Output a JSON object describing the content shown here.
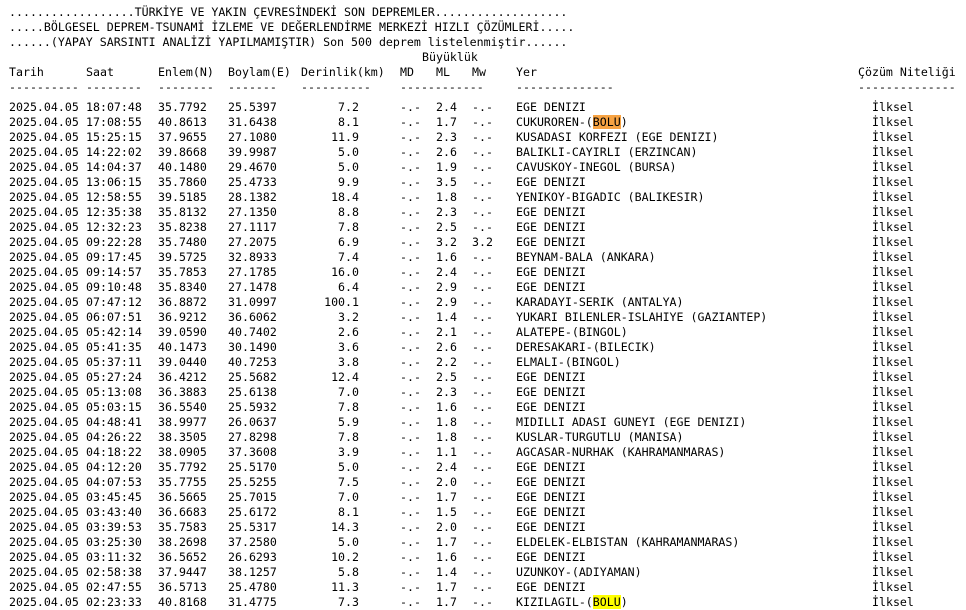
{
  "header": {
    "line1": "..................TÜRKİYE VE YAKIN ÇEVRESİNDEKİ SON DEPREMLER...................",
    "line2": ".....BÖLGESEL DEPREM-TSUNAMİ İZLEME VE DEĞERLENDİRME MERKEZİ HIZLI ÇÖZÜMLERİ.....",
    "line3": "......(YAPAY SARSINTI ANALİZİ YAPILMAMIŞTIR) Son 500 deprem listelenmiştir......"
  },
  "columns": {
    "magnitude_group": "Büyüklük",
    "date": "Tarih",
    "time": "Saat",
    "lat": "Enlem(N)",
    "lon": "Boylam(E)",
    "depth": "Derinlik(km)",
    "md": "MD",
    "ml": "ML",
    "mw": "Mw",
    "place": "Yer",
    "quality": "Çözüm Niteliği"
  },
  "separators": {
    "date": "----------",
    "time": "--------",
    "lat": "--------",
    "lon": "-------",
    "depth": "----------",
    "mag": "------------",
    "place": "--------------",
    "quality": "--------------"
  },
  "rows": [
    {
      "date": "2025.04.05",
      "time": "18:07:48",
      "lat": "35.7792",
      "lon": "25.5397",
      "depth": "7.2",
      "md": "-.-",
      "ml": "2.4",
      "mw": "-.-",
      "place": "EGE DENIZI",
      "quality": "İlksel"
    },
    {
      "date": "2025.04.05",
      "time": "17:08:55",
      "lat": "40.8613",
      "lon": "31.6438",
      "depth": "8.1",
      "md": "-.-",
      "ml": "1.7",
      "mw": "-.-",
      "place_pre": "CUKUROREN-(",
      "place_mark": "BOLU",
      "place_post": ")",
      "mark": "orange",
      "quality": "İlksel"
    },
    {
      "date": "2025.04.05",
      "time": "15:25:15",
      "lat": "37.9655",
      "lon": "27.1080",
      "depth": "11.9",
      "md": "-.-",
      "ml": "2.3",
      "mw": "-.-",
      "place": "KUSADASI KORFEZI (EGE DENIZI)",
      "quality": "İlksel"
    },
    {
      "date": "2025.04.05",
      "time": "14:22:02",
      "lat": "39.8668",
      "lon": "39.9987",
      "depth": "5.0",
      "md": "-.-",
      "ml": "2.6",
      "mw": "-.-",
      "place": "BALIKLI-CAYIRLI (ERZINCAN)",
      "quality": "İlksel"
    },
    {
      "date": "2025.04.05",
      "time": "14:04:37",
      "lat": "40.1480",
      "lon": "29.4670",
      "depth": "5.0",
      "md": "-.-",
      "ml": "1.9",
      "mw": "-.-",
      "place": "CAVUSKOY-INEGOL (BURSA)",
      "quality": "İlksel"
    },
    {
      "date": "2025.04.05",
      "time": "13:06:15",
      "lat": "35.7860",
      "lon": "25.4733",
      "depth": "9.9",
      "md": "-.-",
      "ml": "3.5",
      "mw": "-.-",
      "place": "EGE DENIZI",
      "quality": "İlksel"
    },
    {
      "date": "2025.04.05",
      "time": "12:58:55",
      "lat": "39.5185",
      "lon": "28.1382",
      "depth": "18.4",
      "md": "-.-",
      "ml": "1.8",
      "mw": "-.-",
      "place": "YENIKOY-BIGADIC (BALIKESIR)",
      "quality": "İlksel"
    },
    {
      "date": "2025.04.05",
      "time": "12:35:38",
      "lat": "35.8132",
      "lon": "27.1350",
      "depth": "8.8",
      "md": "-.-",
      "ml": "2.3",
      "mw": "-.-",
      "place": "EGE DENIZI",
      "quality": "İlksel"
    },
    {
      "date": "2025.04.05",
      "time": "12:32:23",
      "lat": "35.8238",
      "lon": "27.1117",
      "depth": "7.8",
      "md": "-.-",
      "ml": "2.5",
      "mw": "-.-",
      "place": "EGE DENIZI",
      "quality": "İlksel"
    },
    {
      "date": "2025.04.05",
      "time": "09:22:28",
      "lat": "35.7480",
      "lon": "27.2075",
      "depth": "6.9",
      "md": "-.-",
      "ml": "3.2",
      "mw": "3.2",
      "place": "EGE DENIZI",
      "quality": "İlksel"
    },
    {
      "date": "2025.04.05",
      "time": "09:17:45",
      "lat": "39.5725",
      "lon": "32.8933",
      "depth": "7.4",
      "md": "-.-",
      "ml": "1.6",
      "mw": "-.-",
      "place": "BEYNAM-BALA (ANKARA)",
      "quality": "İlksel"
    },
    {
      "date": "2025.04.05",
      "time": "09:14:57",
      "lat": "35.7853",
      "lon": "27.1785",
      "depth": "16.0",
      "md": "-.-",
      "ml": "2.4",
      "mw": "-.-",
      "place": "EGE DENIZI",
      "quality": "İlksel"
    },
    {
      "date": "2025.04.05",
      "time": "09:10:48",
      "lat": "35.8340",
      "lon": "27.1478",
      "depth": "6.4",
      "md": "-.-",
      "ml": "2.9",
      "mw": "-.-",
      "place": "EGE DENIZI",
      "quality": "İlksel"
    },
    {
      "date": "2025.04.05",
      "time": "07:47:12",
      "lat": "36.8872",
      "lon": "31.0997",
      "depth": "100.1",
      "md": "-.-",
      "ml": "2.9",
      "mw": "-.-",
      "place": "KARADAYI-SERIK (ANTALYA)",
      "quality": "İlksel"
    },
    {
      "date": "2025.04.05",
      "time": "06:07:51",
      "lat": "36.9212",
      "lon": "36.6062",
      "depth": "3.2",
      "md": "-.-",
      "ml": "1.4",
      "mw": "-.-",
      "place": "YUKARI BILENLER-ISLAHIYE (GAZIANTEP)",
      "quality": "İlksel"
    },
    {
      "date": "2025.04.05",
      "time": "05:42:14",
      "lat": "39.0590",
      "lon": "40.7402",
      "depth": "2.6",
      "md": "-.-",
      "ml": "2.1",
      "mw": "-.-",
      "place": "ALATEPE-(BINGOL)",
      "quality": "İlksel"
    },
    {
      "date": "2025.04.05",
      "time": "05:41:35",
      "lat": "40.1473",
      "lon": "30.1490",
      "depth": "3.6",
      "md": "-.-",
      "ml": "2.6",
      "mw": "-.-",
      "place": "DERESAKARI-(BILECIK)",
      "quality": "İlksel"
    },
    {
      "date": "2025.04.05",
      "time": "05:37:11",
      "lat": "39.0440",
      "lon": "40.7253",
      "depth": "3.8",
      "md": "-.-",
      "ml": "2.2",
      "mw": "-.-",
      "place": "ELMALI-(BINGOL)",
      "quality": "İlksel"
    },
    {
      "date": "2025.04.05",
      "time": "05:27:24",
      "lat": "36.4212",
      "lon": "25.5682",
      "depth": "12.4",
      "md": "-.-",
      "ml": "2.5",
      "mw": "-.-",
      "place": "EGE DENIZI",
      "quality": "İlksel"
    },
    {
      "date": "2025.04.05",
      "time": "05:13:08",
      "lat": "36.3883",
      "lon": "25.6138",
      "depth": "7.0",
      "md": "-.-",
      "ml": "2.3",
      "mw": "-.-",
      "place": "EGE DENIZI",
      "quality": "İlksel"
    },
    {
      "date": "2025.04.05",
      "time": "05:03:15",
      "lat": "36.5540",
      "lon": "25.5932",
      "depth": "7.8",
      "md": "-.-",
      "ml": "1.6",
      "mw": "-.-",
      "place": "EGE DENIZI",
      "quality": "İlksel"
    },
    {
      "date": "2025.04.05",
      "time": "04:48:41",
      "lat": "38.9977",
      "lon": "26.0637",
      "depth": "5.9",
      "md": "-.-",
      "ml": "1.8",
      "mw": "-.-",
      "place": "MIDILLI ADASI GUNEYI (EGE DENIZI)",
      "quality": "İlksel"
    },
    {
      "date": "2025.04.05",
      "time": "04:26:22",
      "lat": "38.3505",
      "lon": "27.8298",
      "depth": "7.8",
      "md": "-.-",
      "ml": "1.8",
      "mw": "-.-",
      "place": "KUSLAR-TURGUTLU (MANISA)",
      "quality": "İlksel"
    },
    {
      "date": "2025.04.05",
      "time": "04:18:22",
      "lat": "38.0905",
      "lon": "37.3608",
      "depth": "3.9",
      "md": "-.-",
      "ml": "1.1",
      "mw": "-.-",
      "place": "AGCASAR-NURHAK (KAHRAMANMARAS)",
      "quality": "İlksel"
    },
    {
      "date": "2025.04.05",
      "time": "04:12:20",
      "lat": "35.7792",
      "lon": "25.5170",
      "depth": "5.0",
      "md": "-.-",
      "ml": "2.4",
      "mw": "-.-",
      "place": "EGE DENIZI",
      "quality": "İlksel"
    },
    {
      "date": "2025.04.05",
      "time": "04:07:53",
      "lat": "35.7755",
      "lon": "25.5255",
      "depth": "7.5",
      "md": "-.-",
      "ml": "2.0",
      "mw": "-.-",
      "place": "EGE DENIZI",
      "quality": "İlksel"
    },
    {
      "date": "2025.04.05",
      "time": "03:45:45",
      "lat": "36.5665",
      "lon": "25.7015",
      "depth": "7.0",
      "md": "-.-",
      "ml": "1.7",
      "mw": "-.-",
      "place": "EGE DENIZI",
      "quality": "İlksel"
    },
    {
      "date": "2025.04.05",
      "time": "03:43:40",
      "lat": "36.6683",
      "lon": "25.6172",
      "depth": "8.1",
      "md": "-.-",
      "ml": "1.5",
      "mw": "-.-",
      "place": "EGE DENIZI",
      "quality": "İlksel"
    },
    {
      "date": "2025.04.05",
      "time": "03:39:53",
      "lat": "35.7583",
      "lon": "25.5317",
      "depth": "14.3",
      "md": "-.-",
      "ml": "2.0",
      "mw": "-.-",
      "place": "EGE DENIZI",
      "quality": "İlksel"
    },
    {
      "date": "2025.04.05",
      "time": "03:25:30",
      "lat": "38.2698",
      "lon": "37.2580",
      "depth": "5.0",
      "md": "-.-",
      "ml": "1.7",
      "mw": "-.-",
      "place": "ELDELEK-ELBISTAN (KAHRAMANMARAS)",
      "quality": "İlksel"
    },
    {
      "date": "2025.04.05",
      "time": "03:11:32",
      "lat": "36.5652",
      "lon": "26.6293",
      "depth": "10.2",
      "md": "-.-",
      "ml": "1.6",
      "mw": "-.-",
      "place": "EGE DENIZI",
      "quality": "İlksel"
    },
    {
      "date": "2025.04.05",
      "time": "02:58:38",
      "lat": "37.9447",
      "lon": "38.1257",
      "depth": "5.8",
      "md": "-.-",
      "ml": "1.4",
      "mw": "-.-",
      "place": "UZUNKOY-(ADIYAMAN)",
      "quality": "İlksel"
    },
    {
      "date": "2025.04.05",
      "time": "02:47:55",
      "lat": "36.5713",
      "lon": "25.4780",
      "depth": "11.3",
      "md": "-.-",
      "ml": "1.7",
      "mw": "-.-",
      "place": "EGE DENIZI",
      "quality": "İlksel"
    },
    {
      "date": "2025.04.05",
      "time": "02:23:33",
      "lat": "40.8168",
      "lon": "31.4775",
      "depth": "7.3",
      "md": "-.-",
      "ml": "1.7",
      "mw": "-.-",
      "place_pre": "KIZILAGIL-(",
      "place_mark": "BOLU",
      "place_post": ")",
      "mark": "yellow",
      "quality": "İlksel"
    }
  ],
  "colors": {
    "text": "#000000",
    "background": "#ffffff",
    "highlight_orange": "#f7a343",
    "highlight_yellow": "#ffff00"
  }
}
